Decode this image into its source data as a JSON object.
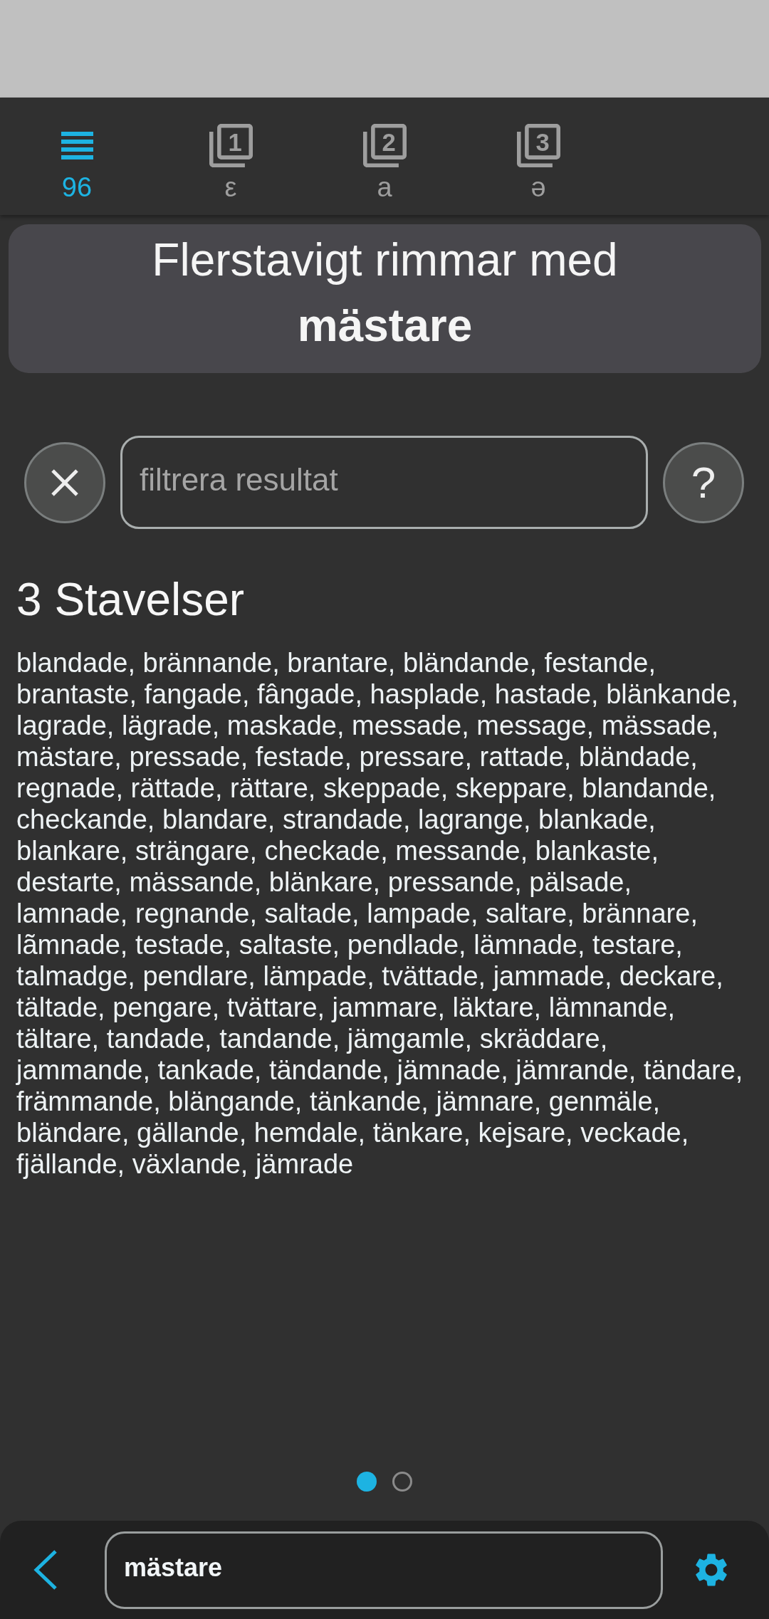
{
  "tabs": [
    {
      "kind": "list",
      "label": "96",
      "selected": true
    },
    {
      "kind": "numbered",
      "number": "1",
      "label": "ε",
      "selected": false
    },
    {
      "kind": "numbered",
      "number": "2",
      "label": "a",
      "selected": false
    },
    {
      "kind": "numbered",
      "number": "3",
      "label": "ə",
      "selected": false
    }
  ],
  "header": {
    "title": "Flerstavigt rimmar med",
    "word": "mästare"
  },
  "filter": {
    "placeholder": "filtrera resultat",
    "help_label": "?"
  },
  "results": [
    {
      "heading": "3 Stavelser",
      "words": "blandade, brännande, brantare, bländande, festande, brantaste, fangade, fângade, hasplade, hastade, blänkande, lagrade, lägrade, maskade, messade, message, mässade, mästare, pressade, festade, pressare, rattade, bländade, regnade, rättade, rättare, skeppade, skeppare, blandande, checkande, blandare, strandade, lagrange, blankade, blankare, strängare, checkade, messande, blankaste, destarte, mässande, blänkare, pressande, pälsade, lamnade, regnande, saltade, lampade, saltare, brännare, lãmnade, testade, saltaste, pendlade, lämnade, testare, talmadge, pendlare, lämpade, tvättade, jammade, deckare, tältade, pengare, tvättare, jammare, läktare, lämnande, tältare, tandade, tandande, jämgamle, skräddare, jammande, tankade, tändande, jämnade, jämrande, tändare, främmande, blängande, tänkande, jämnare, genmäle, bländare, gällande, hemdale, tänkare, kejsare, veckade, fjällande, växlande, jämrade"
    }
  ],
  "pager": [
    {
      "selected": true
    },
    {
      "selected": false
    }
  ],
  "search": {
    "value": "mästare"
  }
}
